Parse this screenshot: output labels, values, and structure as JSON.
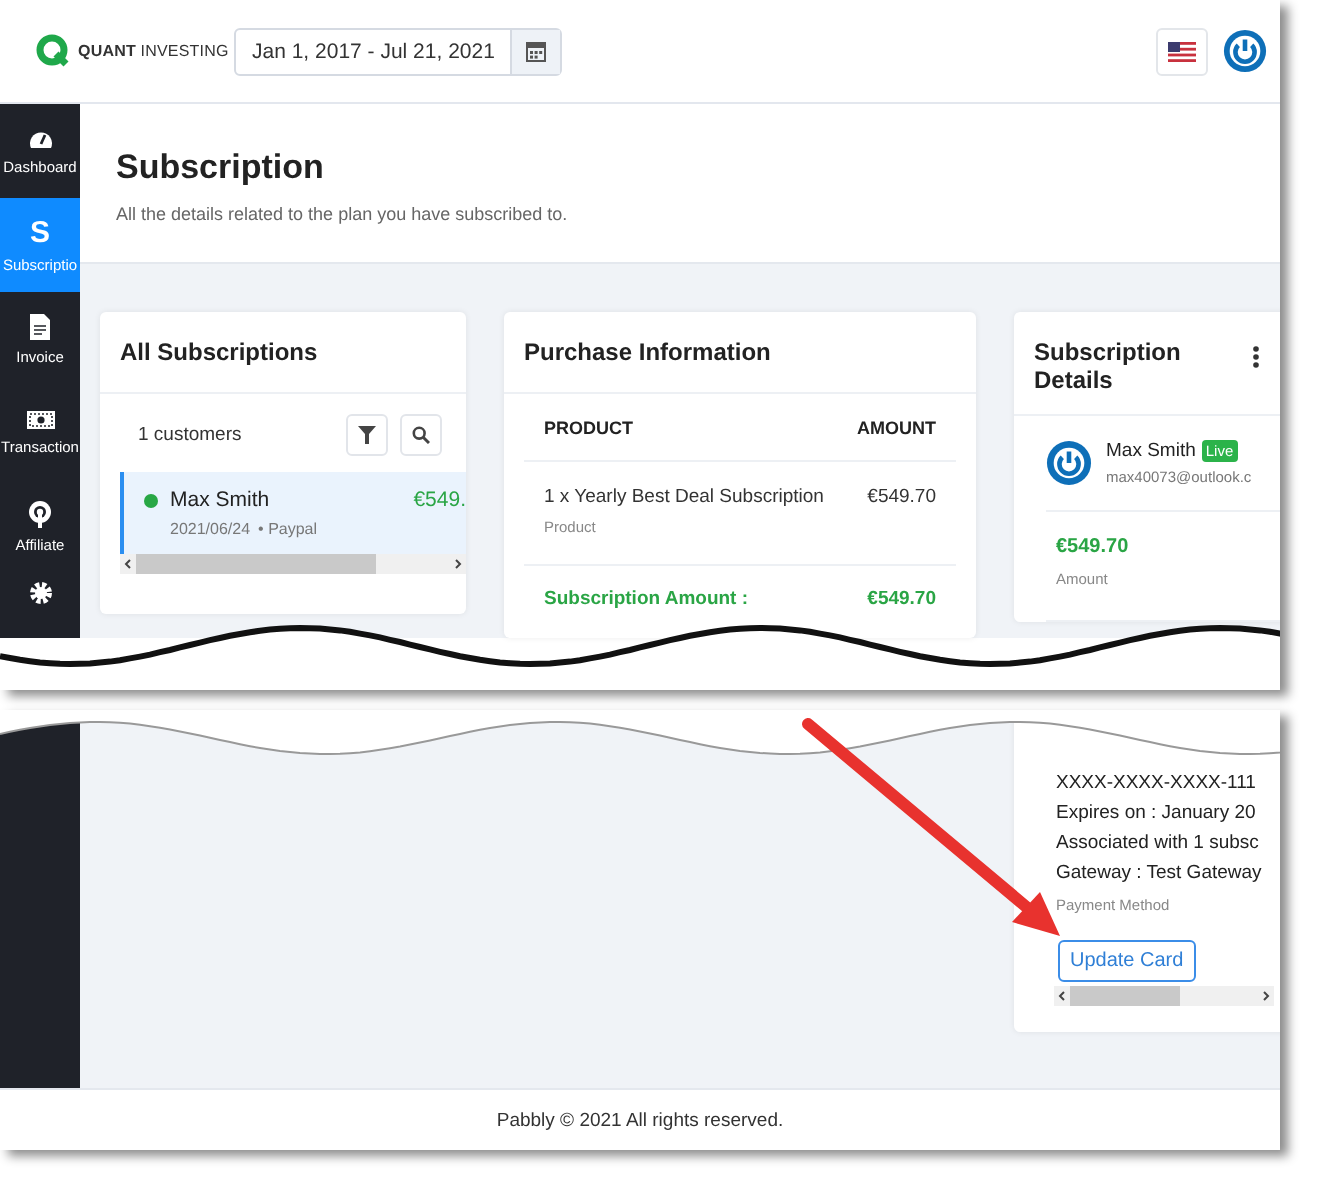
{
  "header": {
    "logo_text": "**QUANT** INVESTING",
    "date_range": "Jan 1, 2017 - Jul 21, 2021"
  },
  "sidebar": {
    "items": [
      {
        "kind": "gauge",
        "label": "Dashboard",
        "selected": false
      },
      {
        "kind": "letter",
        "glyph": "S",
        "label": "Subscriptio",
        "selected": true
      },
      {
        "kind": "document",
        "label": "Invoice",
        "selected": false
      },
      {
        "kind": "money",
        "label": "Transaction",
        "selected": false
      },
      {
        "kind": "antenna",
        "label": "Affiliate",
        "selected": false
      },
      {
        "kind": "gear",
        "selected": false
      }
    ]
  },
  "page": {
    "title": "Subscription",
    "subtitle": "All the details related to the plan you have subscribed to."
  },
  "all_subscriptions": {
    "title": "All Subscriptions",
    "count": "1 customers",
    "rows": [
      {
        "name": "Max Smith",
        "amount": "€549.",
        "date": "2021/06/24",
        "method": "• Paypal",
        "selected": true,
        "color": "#28a745"
      }
    ]
  },
  "purchase_information": {
    "title": "Purchase Information",
    "columns": [
      "PRODUCT",
      "AMOUNT"
    ],
    "items": [
      {
        "name": "1 x Yearly Best Deal Subscription",
        "type": "Product",
        "amount": "€549.70"
      }
    ],
    "total": {
      "label": "Subscription Amount :",
      "amount": "€549.70"
    }
  },
  "subscription_details": {
    "title": "Subscription Details",
    "customer": {
      "name": "Max Smith",
      "status": "Live",
      "email": "max40073@outlook.c"
    },
    "amount": "€549.70",
    "amount_label": "Amount",
    "payment": {
      "lines": [
        "XXXX-XXXX-XXXX-111",
        "Expires on : January 20",
        "Associated with 1 subsc",
        "Gateway : Test Gateway"
      ],
      "label": "Payment Method"
    },
    "button": "Update Card"
  },
  "footer": "Pabbly © 2021 All rights reserved."
}
